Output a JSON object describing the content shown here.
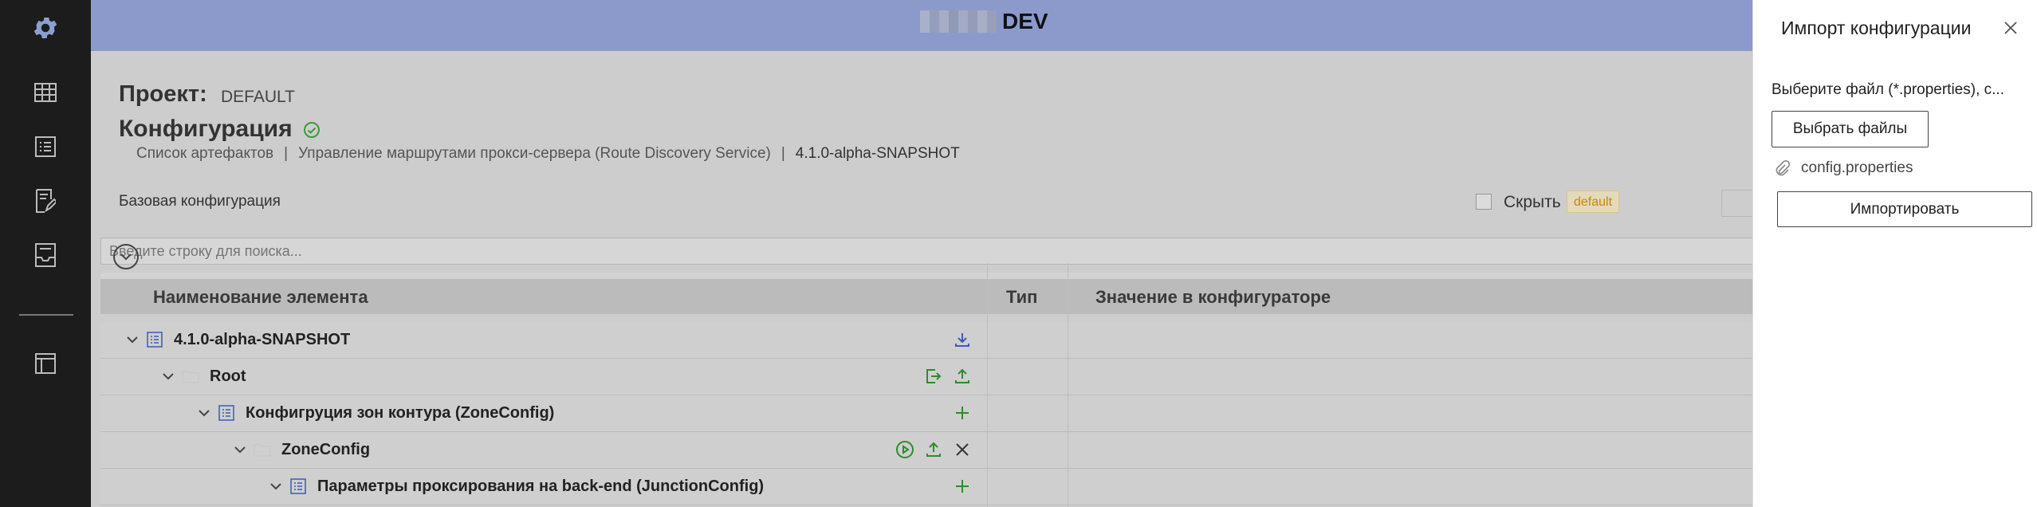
{
  "header": {
    "env_label": "DEV"
  },
  "sidebar": {
    "items": [
      {
        "icon": "gear-icon"
      },
      {
        "icon": "table-icon"
      },
      {
        "icon": "list-icon"
      },
      {
        "icon": "document-edit-icon"
      },
      {
        "icon": "inbox-icon"
      },
      {
        "icon": "layout-icon"
      }
    ]
  },
  "page": {
    "project_label": "Проект:",
    "project_value": "DEFAULT",
    "title": "Конфигурация",
    "breadcrumbs": [
      "Список артефактов",
      "Управление маршрутами прокси-сервера (Route Discovery Service)",
      "4.1.0-alpha-SNAPSHOT"
    ],
    "breadcrumb_sep": "|",
    "base_config": "Базовая конфигурация",
    "hide_label": "Скрыть",
    "hide_badge": "default",
    "search_placeholder": "Введите строку для поиска..."
  },
  "table": {
    "columns": [
      "Наименование элемента",
      "Тип",
      "Значение в конфигураторе"
    ],
    "rows": [
      {
        "label": "4.1.0-alpha-SNAPSHOT",
        "level": 0,
        "icon": "list-icon",
        "actions": [
          "download-icon"
        ]
      },
      {
        "label": "Root",
        "level": 1,
        "icon": "folder-icon",
        "actions": [
          "export-icon",
          "upload-icon"
        ]
      },
      {
        "label": "Конфигруция зон контура (ZoneConfig)",
        "level": 2,
        "icon": "list-icon",
        "actions": [
          "plus-icon"
        ]
      },
      {
        "label": "ZoneConfig",
        "level": 3,
        "icon": "folder-icon",
        "actions": [
          "play-icon",
          "upload-icon",
          "close-icon"
        ]
      },
      {
        "label": "Параметры проксирования на back-end (JunctionConfig)",
        "level": 4,
        "icon": "list-icon",
        "actions": [
          "plus-icon"
        ]
      }
    ]
  },
  "panel": {
    "title": "Импорт конфигурации",
    "description": "Выберите файл (*.properties), с...",
    "choose_button": "Выбрать файлы",
    "file_name": "config.properties",
    "import_button": "Импортировать"
  },
  "colors": {
    "sidebar": "#1c1c1c",
    "topbar": "#8c9acb",
    "action_green": "#2e8b2e",
    "action_blue": "#3b5bb5",
    "badge_text": "#c48a00"
  }
}
